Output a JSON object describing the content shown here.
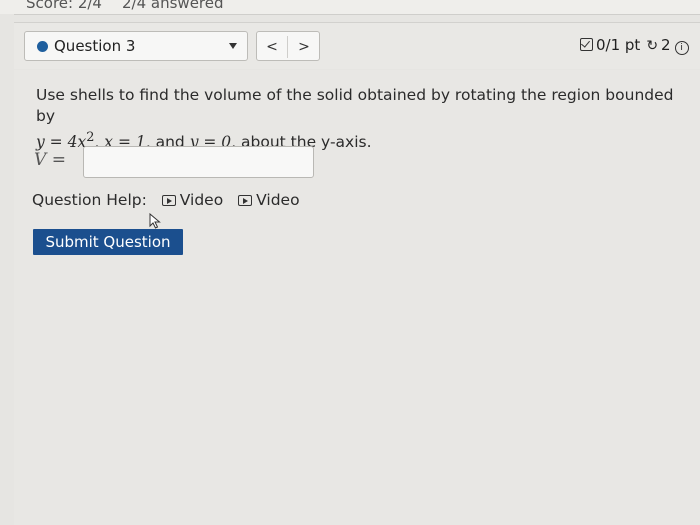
{
  "header": {
    "score": "Score: 2/4",
    "answered": "2/4 answered"
  },
  "question_bar": {
    "selected_question": "Question 3",
    "prev_label": "<",
    "next_label": ">",
    "points": "0/1 pt",
    "retries": "2"
  },
  "question": {
    "intro": "Use shells to find the volume of the solid obtained by rotating the region bounded by",
    "eq1": "y = 4x",
    "eq1_exp": "2",
    "eq2": "x = 1",
    "and_text": "and",
    "eq3": "y = 0",
    "tail": "about the y-axis."
  },
  "answer": {
    "label_var": "V",
    "label_eq": "=",
    "value": ""
  },
  "help": {
    "label": "Question Help:",
    "links": [
      "Video",
      "Video"
    ]
  },
  "submit_label": "Submit Question",
  "colors": {
    "submit_bg": "#1b4f8e",
    "question_dot": "#1f5f9e"
  }
}
